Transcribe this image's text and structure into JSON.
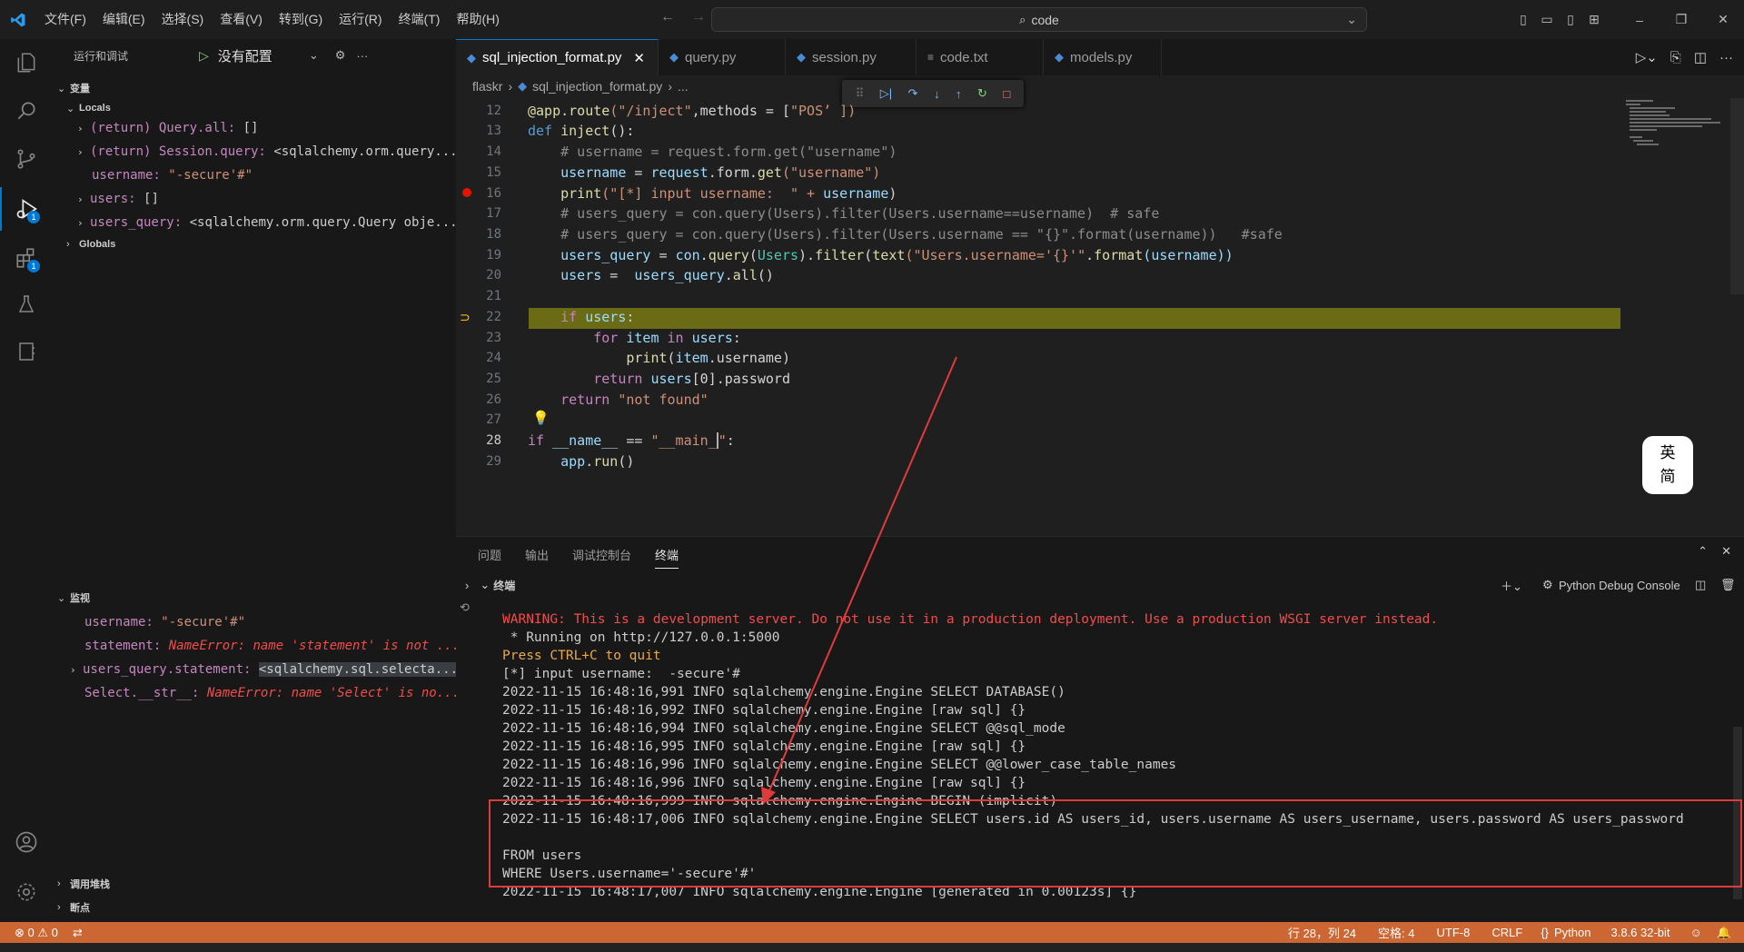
{
  "menu": [
    "文件(F)",
    "编辑(E)",
    "选择(S)",
    "查看(V)",
    "转到(G)",
    "运行(R)",
    "终端(T)",
    "帮助(H)"
  ],
  "search": {
    "text": "code"
  },
  "sidebar": {
    "title": "运行和调试",
    "config": "没有配置",
    "variables_title": "变量",
    "locals_title": "Locals",
    "globals_title": "Globals",
    "locals": [
      {
        "name": "(return) Query.all:",
        "value": "[]"
      },
      {
        "name": "(return) Session.query:",
        "value": "<sqlalchemy.orm.query..."
      },
      {
        "name": "username:",
        "value": "\"-secure'#\""
      },
      {
        "name": "users:",
        "value": "[]"
      },
      {
        "name": "users_query:",
        "value": "<sqlalchemy.orm.query.Query obje..."
      }
    ],
    "watch_title": "监视",
    "watch": [
      {
        "name": "username:",
        "value": "\"-secure'#\""
      },
      {
        "name": "statement:",
        "value": "NameError: name 'statement' is not ..."
      },
      {
        "name": "users_query.statement:",
        "value": "<sqlalchemy.sql.selecta..."
      },
      {
        "name": "Select.__str__:",
        "value": "NameError: name 'Select' is no..."
      }
    ],
    "callstack_title": "调用堆栈",
    "breakpoints_title": "断点"
  },
  "tabs": [
    "sql_injection_format.py",
    "query.py",
    "session.py",
    "code.txt",
    "models.py"
  ],
  "breadcrumb": [
    "flaskr",
    "sql_injection_format.py",
    "..."
  ],
  "code": {
    "l12": [
      "@app.route(\"/inject\",methods = [\"POS’ ])"
    ],
    "lines": [
      {
        "n": "12"
      },
      {
        "n": "13"
      },
      {
        "n": "14"
      },
      {
        "n": "15"
      },
      {
        "n": "16"
      },
      {
        "n": "17"
      },
      {
        "n": "18"
      },
      {
        "n": "19"
      },
      {
        "n": "20"
      },
      {
        "n": "21"
      },
      {
        "n": "22"
      },
      {
        "n": "23"
      },
      {
        "n": "24"
      },
      {
        "n": "25"
      },
      {
        "n": "26"
      },
      {
        "n": "27"
      },
      {
        "n": "28"
      },
      {
        "n": "29"
      }
    ],
    "t12a": "@app",
    ".t12b": "",
    "src": {
      "s12_1": "@app",
      ".": "",
      "s12_2": ".route",
      "s12_3": "(\"/inject\"",
      "s12_4": ",methods = [",
      "s12_5": "\"POS’ ])",
      "s13_1": "def ",
      "s13_2": "inject",
      "s13_3": "():",
      "s14": "    # username = request.form.get(\"username\")",
      "s15_1": "    username",
      "s15_2": " = ",
      "s15_3": "request",
      "s15_4": ".form.",
      "s15_5": "get",
      "s15_6": "(\"username\")",
      "s16_1": "    print",
      "s16_2": "(\"[*] input username:  \" + ",
      "s16_3": "username",
      ")": "",
      "s16_4": ")",
      "s17": "    # users_query = con.query(Users).filter(Users.username==username)  # safe",
      "s18": "    # users_query = con.query(Users).filter(Users.username == \"{}\".format(username))   #safe",
      "s19_1": "    users_query",
      "s19_2": " = ",
      "s19_3": "con",
      "s19_4": ".",
      "s19_5": "query",
      "s19_6": "(",
      "s19_7": "Users",
      "s19_8": ").",
      "s19_9": "filter",
      "s19_10": "(",
      "s19_11": "text",
      "s19_12": "(\"Users.username='{}'\"",
      "s19_13": ".",
      "s19_14": "format",
      "s19_15": "(username))",
      "s20_1": "    users",
      "s20_2": " =  ",
      "s20_3": "users_query",
      "s20_4": ".",
      "s20_5": "all",
      "s20_6": "()",
      "s22_1": "    if ",
      "s22_2": "users",
      ":": "",
      "s22_3": ":",
      "s23_1": "        for ",
      "s23_2": "item",
      " in ": "",
      "s23_3": " in ",
      "s23_4": "users",
      "s23_5": ":",
      "s24_1": "            print",
      "s24_2": "(",
      "s24_3": "item",
      "s24_4": ".username)",
      "s25_1": "        return ",
      "s25_2": "users",
      "s25_3": "[0].password",
      "s26_1": "    return ",
      "s26_2": "\"not found\"",
      "s28_1": "if ",
      "s28_2": "__name__",
      " == ": "",
      "s28_3": " == ",
      "s28_4": "\"__main_",
      "s28_5": "\"",
      ":2": "",
      "s28_6": ":",
      "s29_1": "    app",
      "s29_2": ".",
      "s29_3": "run",
      "s29_4": "()"
    }
  },
  "panel": {
    "tabs": [
      "问题",
      "输出",
      "调试控制台",
      "终端"
    ],
    "terminal_title": "终端",
    "console_name": "Python Debug Console"
  },
  "terminal": [
    "WARNING: This is a development server. Do not use it in a production deployment. Use a production WSGI server instead.",
    " * Running on http://127.0.0.1:5000",
    "Press CTRL+C to quit",
    "[*] input username:  -secure'#",
    "2022-11-15 16:48:16,991 INFO sqlalchemy.engine.Engine SELECT DATABASE()",
    "2022-11-15 16:48:16,992 INFO sqlalchemy.engine.Engine [raw sql] {}",
    "2022-11-15 16:48:16,994 INFO sqlalchemy.engine.Engine SELECT @@sql_mode",
    "2022-11-15 16:48:16,995 INFO sqlalchemy.engine.Engine [raw sql] {}",
    "2022-11-15 16:48:16,996 INFO sqlalchemy.engine.Engine SELECT @@lower_case_table_names",
    "2022-11-15 16:48:16,996 INFO sqlalchemy.engine.Engine [raw sql] {}",
    "2022-11-15 16:48:16,999 INFO sqlalchemy.engine.Engine BEGIN (implicit)",
    "2022-11-15 16:48:17,006 INFO sqlalchemy.engine.Engine SELECT users.id AS users_id, users.username AS users_username, users.password AS users_password",
    "",
    "FROM users",
    "WHERE Users.username='-secure'#'",
    "2022-11-15 16:48:17,007 INFO sqlalchemy.engine.Engine [generated in 0.00123s] {}"
  ],
  "status": {
    "errors": "0",
    "warnings": "0",
    "position": "行 28，列 24",
    "spaces": "空格: 4",
    "encoding": "UTF-8",
    "eol": "CRLF",
    "language": "Python",
    "interpreter": "3.8.6 32-bit"
  },
  "ime": {
    "line1": "英",
    "line2": "简"
  },
  "colors": {
    "statusbar": "#cc6633",
    "accent": "#0078d4",
    "highlight": "#6b6b16",
    "annotation": "#e03b3b"
  }
}
